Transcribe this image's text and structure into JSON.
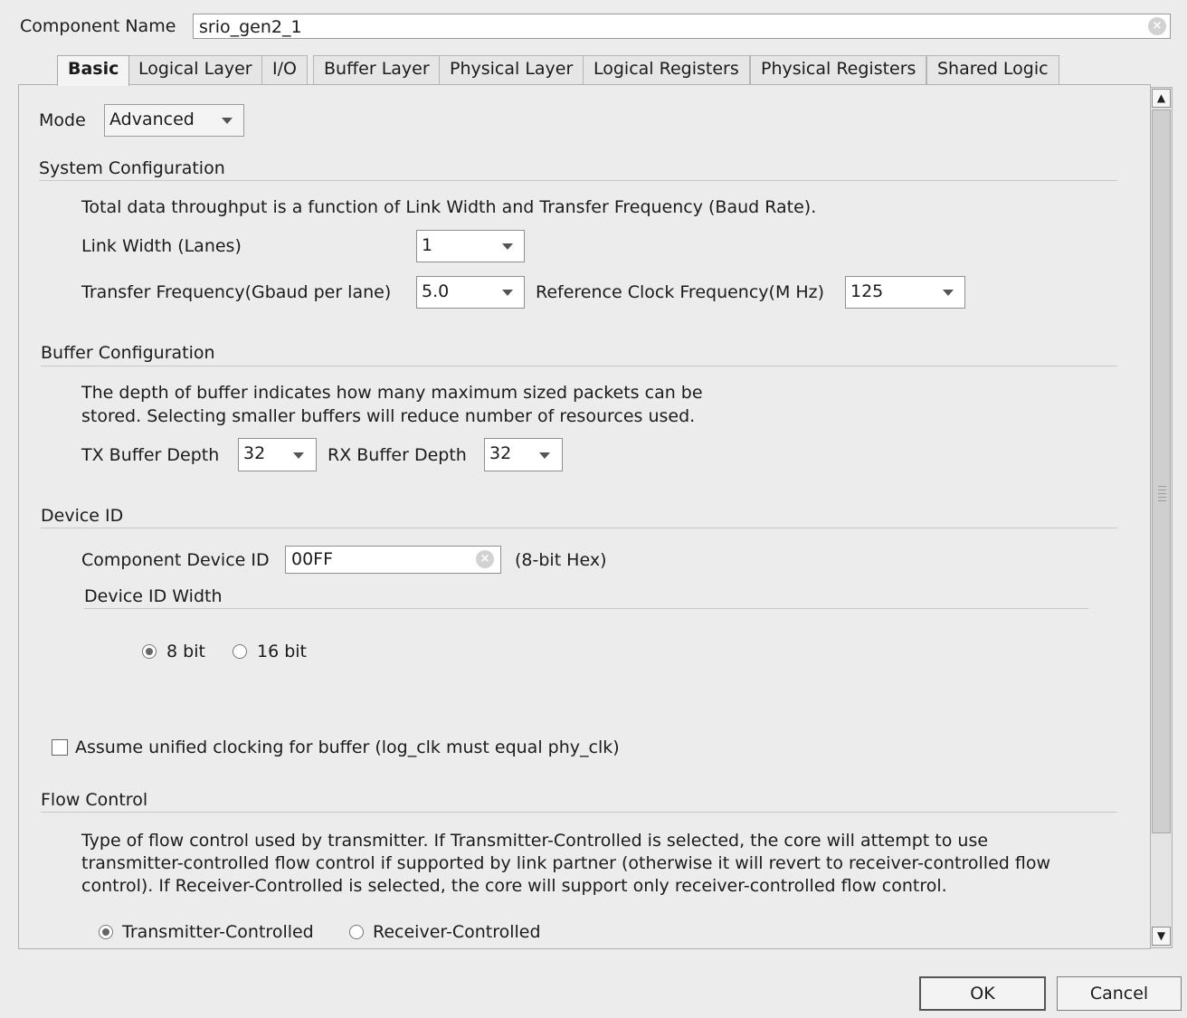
{
  "component_name": {
    "label": "Component Name",
    "value": "srio_gen2_1"
  },
  "tabs": [
    {
      "label": "Basic"
    },
    {
      "label": "Logical Layer"
    },
    {
      "label": "I/O"
    },
    {
      "label": "Buffer Layer"
    },
    {
      "label": "Physical Layer"
    },
    {
      "label": "Logical Registers"
    },
    {
      "label": "Physical Registers"
    },
    {
      "label": "Shared Logic"
    }
  ],
  "mode": {
    "label": "Mode",
    "value": "Advanced"
  },
  "system": {
    "title": "System Configuration",
    "description": "Total data throughput is a function of Link Width and Transfer Frequency (Baud Rate).",
    "link_width": {
      "label": "Link Width (Lanes)",
      "value": "1"
    },
    "transfer_freq": {
      "label": "Transfer Frequency(Gbaud per lane)",
      "value": "5.0"
    },
    "ref_clock": {
      "label": "Reference Clock Frequency(M Hz)",
      "value": "125"
    }
  },
  "buffer": {
    "title": "Buffer Configuration",
    "description_line1": "The depth of buffer indicates how many maximum sized packets can be",
    "description_line2": "stored. Selecting smaller buffers will reduce number of resources used.",
    "tx": {
      "label": "TX Buffer Depth",
      "value": "32"
    },
    "rx": {
      "label": "RX Buffer Depth",
      "value": "32"
    }
  },
  "device_id": {
    "title": "Device ID",
    "component_label": "Component Device ID",
    "component_value": "00FF",
    "hint": "(8-bit Hex)",
    "width_title": "Device ID Width",
    "options": [
      {
        "label": "8 bit",
        "selected": true
      },
      {
        "label": "16 bit",
        "selected": false
      }
    ]
  },
  "unified_clock": {
    "label": "Assume unified clocking for buffer (log_clk must equal phy_clk)",
    "checked": false
  },
  "flow": {
    "title": "Flow Control",
    "line1": "Type of flow control used by transmitter. If Transmitter-Controlled is selected, the core will attempt to use",
    "line2": "transmitter-controlled flow control if supported by link partner (otherwise it will revert to receiver-controlled flow",
    "line3": "control). If Receiver-Controlled is selected, the core will support only receiver-controlled flow control.",
    "options": [
      {
        "label": "Transmitter-Controlled",
        "selected": true
      },
      {
        "label": "Receiver-Controlled",
        "selected": false
      }
    ]
  },
  "buttons": {
    "ok": "OK",
    "cancel": "Cancel"
  },
  "icons": {
    "clear": "clear-icon",
    "dropdown": "chevron-down-icon",
    "scroll_up": "arrow-up-icon",
    "scroll_down": "arrow-down-icon"
  }
}
